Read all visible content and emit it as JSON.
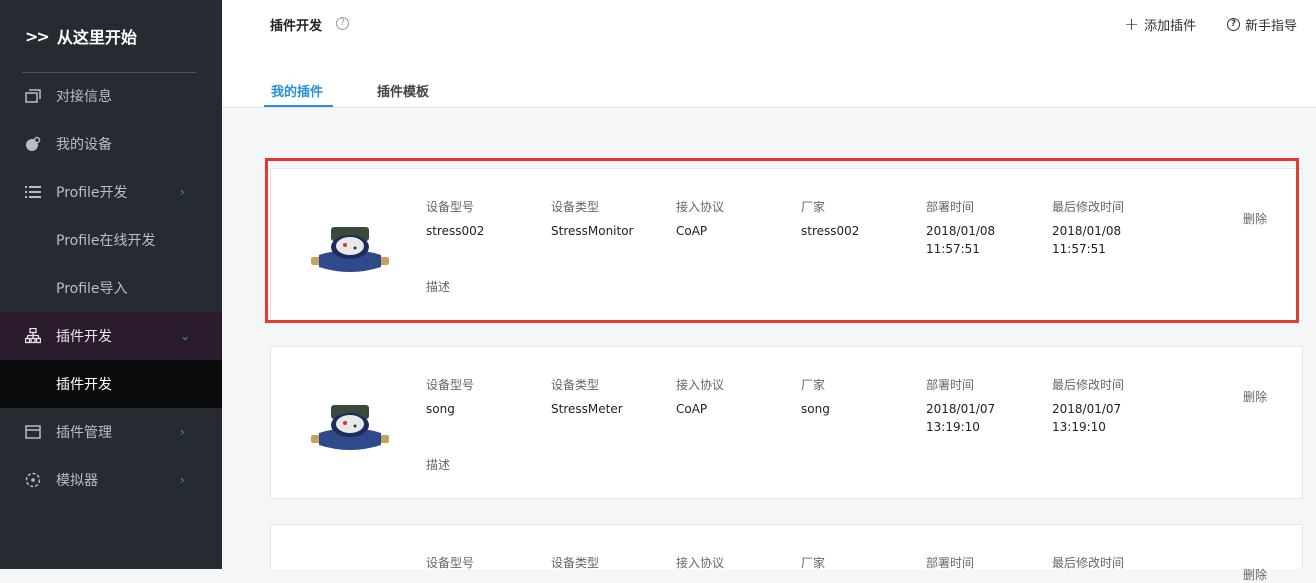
{
  "sidebar": {
    "brand": "从这里开始",
    "items": [
      {
        "label": "对接信息",
        "icon": "window-icon"
      },
      {
        "label": "我的设备",
        "icon": "device-icon"
      },
      {
        "label": "Profile开发",
        "icon": "list-icon"
      },
      {
        "label": "Profile在线开发"
      },
      {
        "label": "Profile导入"
      },
      {
        "label": "插件开发",
        "icon": "org-chart-icon"
      },
      {
        "label": "插件开发"
      },
      {
        "label": "插件管理",
        "icon": "panel-icon"
      },
      {
        "label": "模拟器",
        "icon": "simulator-icon"
      }
    ]
  },
  "header": {
    "title": "插件开发",
    "add_plugin": "添加插件",
    "guide": "新手指导"
  },
  "tabs": [
    "我的插件",
    "插件模板"
  ],
  "labels": {
    "model": "设备型号",
    "type": "设备类型",
    "protocol": "接入协议",
    "vendor": "厂家",
    "deploy_time": "部署时间",
    "modify_time": "最后修改时间",
    "desc": "描述",
    "delete": "删除"
  },
  "plugins": [
    {
      "model": "stress002",
      "type": "StressMonitor",
      "protocol": "CoAP",
      "vendor": "stress002",
      "deploy_date": "2018/01/08",
      "deploy_clock": "11:57:51",
      "modify_date": "2018/01/08",
      "modify_clock": "11:57:51"
    },
    {
      "model": "song",
      "type": "StressMeter",
      "protocol": "CoAP",
      "vendor": "song",
      "deploy_date": "2018/01/07",
      "deploy_clock": "13:19:10",
      "modify_date": "2018/01/07",
      "modify_clock": "13:19:10"
    }
  ],
  "colors": {
    "accent": "#2b90d9",
    "sidebar_bg": "#262b31",
    "highlight": "#e53935"
  }
}
